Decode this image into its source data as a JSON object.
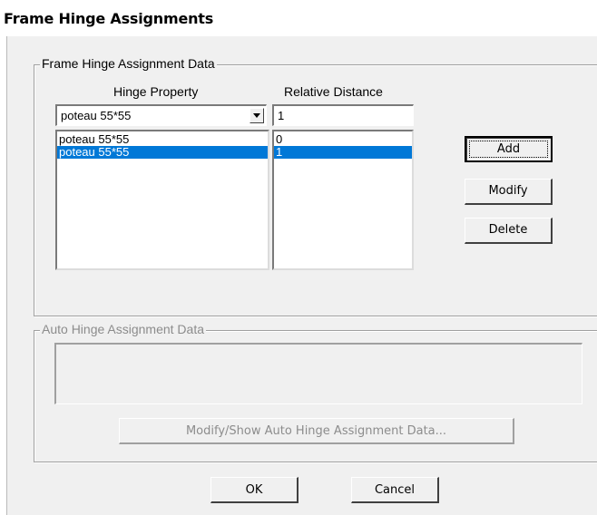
{
  "window": {
    "title": "Frame Hinge Assignments"
  },
  "assignment_group": {
    "legend": "Frame Hinge Assignment Data",
    "hinge_property_header": "Hinge Property",
    "relative_distance_header": "Relative Distance",
    "hinge_property_combo": {
      "value": "poteau 55*55",
      "icon": "chevron-down-icon"
    },
    "relative_distance_input": {
      "value": "1"
    },
    "hinge_list": [
      {
        "label": "poteau 55*55",
        "selected": false
      },
      {
        "label": "poteau 55*55",
        "selected": true
      }
    ],
    "distance_list": [
      {
        "label": "0",
        "selected": false
      },
      {
        "label": "1",
        "selected": true
      }
    ],
    "buttons": {
      "add": "Add",
      "modify": "Modify",
      "delete": "Delete"
    }
  },
  "auto_group": {
    "legend": "Auto Hinge Assignment Data",
    "display_text": "",
    "modify_show_button": "Modify/Show Auto Hinge Assignment Data..."
  },
  "dialog_buttons": {
    "ok": "OK",
    "cancel": "Cancel"
  },
  "colors": {
    "selection": "#0078d7",
    "face": "#f0f0f0",
    "disabled_text": "#8c8c8c"
  }
}
